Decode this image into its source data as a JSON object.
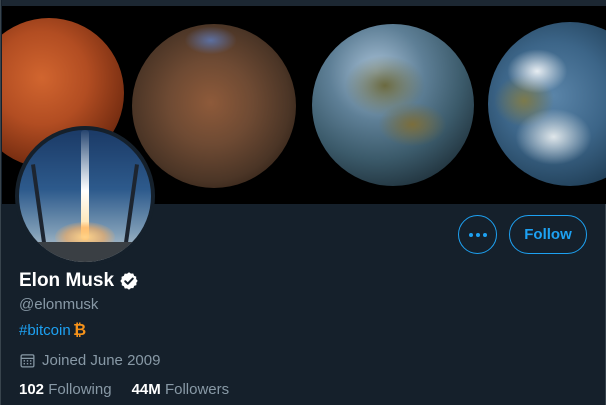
{
  "profile": {
    "name": "Elon Musk",
    "handle": "@elonmusk",
    "bio_hashtag": "#bitcoin",
    "bio_emoji": "bitcoin-icon",
    "joined": "Joined June 2009",
    "verified": true
  },
  "actions": {
    "more_icon": "more-horizontal-icon",
    "follow_label": "Follow"
  },
  "stats": {
    "following_count": "102",
    "following_label": "Following",
    "followers_count": "44M",
    "followers_label": "Followers"
  },
  "colors": {
    "background": "#15202b",
    "accent": "#1da1f2",
    "secondary_text": "#8899a6",
    "bitcoin": "#f7931a"
  }
}
